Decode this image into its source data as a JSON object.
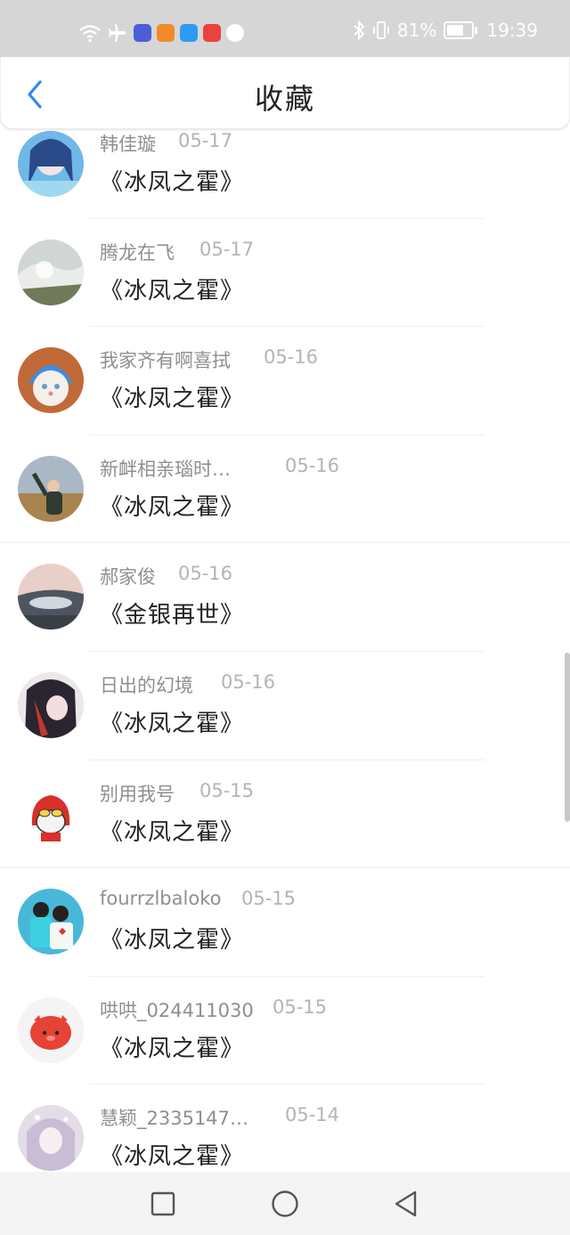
{
  "status_bar": {
    "battery_percent": "81%",
    "time": "19:39",
    "battery_level": 0.81,
    "icons": [
      "wifi-icon",
      "airplane-icon",
      "music-app-icon",
      "video-app-icon",
      "search-app-icon",
      "store-app-icon",
      "ball-app-icon",
      "bluetooth-icon",
      "vibrate-icon",
      "battery-icon"
    ]
  },
  "header": {
    "title": "收藏",
    "back_icon": "chevron-left-icon",
    "accent_color": "#2a8cf0"
  },
  "items": [
    {
      "name": "韩佳璇",
      "date": "05-17",
      "book": "《冰凤之霍》"
    },
    {
      "name": "腾龙在飞",
      "date": "05-17",
      "book": "《冰凤之霍》"
    },
    {
      "name": "我家齐有啊喜拭",
      "date": "05-16",
      "book": "《冰凤之霍》"
    },
    {
      "name": "新衅相亲瑙时…",
      "date": "05-16",
      "book": "《冰凤之霍》"
    },
    {
      "name": "郝家俊",
      "date": "05-16",
      "book": "《金银再世》"
    },
    {
      "name": "日出的幻境",
      "date": "05-16",
      "book": "《冰凤之霍》"
    },
    {
      "name": "别用我号",
      "date": "05-15",
      "book": "《冰凤之霍》"
    },
    {
      "name": "fourrzlbaloko",
      "date": "05-15",
      "book": "《冰凤之霍》"
    },
    {
      "name": "哄哄_024411030",
      "date": "05-15",
      "book": "《冰凤之霍》"
    },
    {
      "name": "慧颖_2335147…",
      "date": "05-14",
      "book": "《冰凤之霍》"
    }
  ],
  "nav_bar": {
    "icons": [
      "square-recents-icon",
      "circle-home-icon",
      "triangle-back-icon"
    ]
  }
}
